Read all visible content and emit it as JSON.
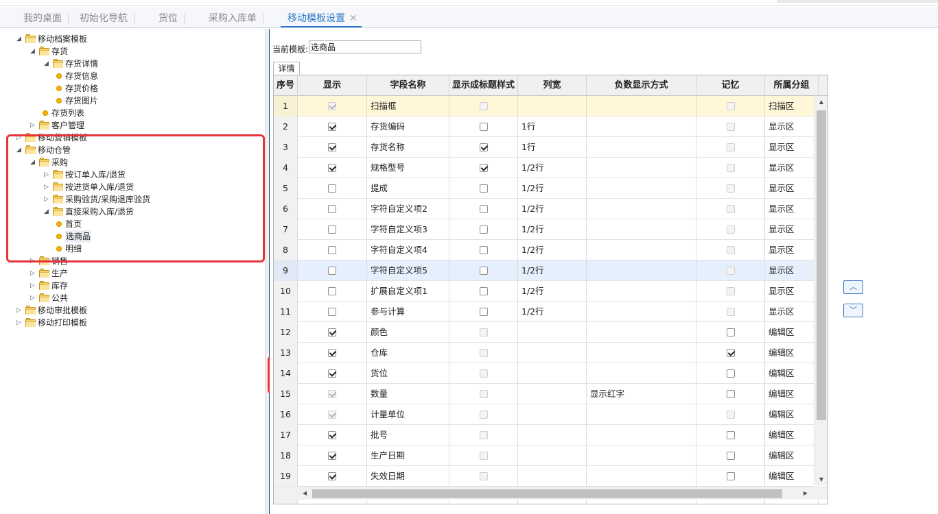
{
  "tabs": [
    {
      "label": "我的桌面"
    },
    {
      "label": "初始化导航"
    },
    {
      "label": "货位"
    },
    {
      "label": "采购入库单"
    },
    {
      "label": "移动模板设置",
      "close": "✕"
    }
  ],
  "tree": {
    "nodes": [
      {
        "label": "移动档案模板",
        "expanded": true
      },
      {
        "label": "存货",
        "expanded": true
      },
      {
        "label": "存货详情",
        "expanded": true
      },
      {
        "label": "存货信息"
      },
      {
        "label": "存货价格"
      },
      {
        "label": "存货图片"
      },
      {
        "label": "存货列表"
      },
      {
        "label": "客户管理",
        "expanded": false
      },
      {
        "label": "移动营销模板",
        "expanded": false
      },
      {
        "label": "移动仓管",
        "expanded": true
      },
      {
        "label": "采购",
        "expanded": true
      },
      {
        "label": "按订单入库/退货",
        "expanded": false
      },
      {
        "label": "按进货单入库/退货",
        "expanded": false
      },
      {
        "label": "采购验货/采购退库验货",
        "expanded": false
      },
      {
        "label": "直接采购入库/退货",
        "expanded": true
      },
      {
        "label": "首页"
      },
      {
        "label": "选商品",
        "selected": true
      },
      {
        "label": "明细"
      },
      {
        "label": "销售",
        "expanded": false
      },
      {
        "label": "生产",
        "expanded": false
      },
      {
        "label": "库存",
        "expanded": false
      },
      {
        "label": "公共",
        "expanded": false
      },
      {
        "label": "移动审批模板",
        "expanded": false
      },
      {
        "label": "移动打印模板",
        "expanded": false
      }
    ]
  },
  "main": {
    "current_template_label": "当前模板:",
    "current_template_value": "选商品",
    "detail_tab": "详情",
    "columns": [
      "序号",
      "显示",
      "字段名称",
      "显示成标题样式",
      "列宽",
      "负数显示方式",
      "记忆",
      "所属分组"
    ],
    "rows": [
      {
        "no": "1",
        "show": true,
        "show_disabled": true,
        "name": "扫描框",
        "title_style": false,
        "title_disabled": true,
        "width": "",
        "negative": "",
        "memory": false,
        "memory_disabled": true,
        "group": "扫描区",
        "highlight": "yellow"
      },
      {
        "no": "2",
        "show": true,
        "show_disabled": false,
        "name": "存货编码",
        "title_style": false,
        "title_disabled": false,
        "width": "1行",
        "negative": "",
        "memory": false,
        "memory_disabled": true,
        "group": "显示区"
      },
      {
        "no": "3",
        "show": true,
        "show_disabled": false,
        "name": "存货名称",
        "title_style": true,
        "title_disabled": false,
        "width": "1行",
        "negative": "",
        "memory": false,
        "memory_disabled": true,
        "group": "显示区"
      },
      {
        "no": "4",
        "show": true,
        "show_disabled": false,
        "name": "规格型号",
        "title_style": true,
        "title_disabled": false,
        "width": "1/2行",
        "negative": "",
        "memory": false,
        "memory_disabled": true,
        "group": "显示区"
      },
      {
        "no": "5",
        "show": false,
        "show_disabled": false,
        "name": "提成",
        "title_style": false,
        "title_disabled": false,
        "width": "1/2行",
        "negative": "",
        "memory": false,
        "memory_disabled": true,
        "group": "显示区"
      },
      {
        "no": "6",
        "show": false,
        "show_disabled": false,
        "name": "字符自定义项2",
        "title_style": false,
        "title_disabled": false,
        "width": "1/2行",
        "negative": "",
        "memory": false,
        "memory_disabled": true,
        "group": "显示区"
      },
      {
        "no": "7",
        "show": false,
        "show_disabled": false,
        "name": "字符自定义项3",
        "title_style": false,
        "title_disabled": false,
        "width": "1/2行",
        "negative": "",
        "memory": false,
        "memory_disabled": true,
        "group": "显示区"
      },
      {
        "no": "8",
        "show": false,
        "show_disabled": false,
        "name": "字符自定义项4",
        "title_style": false,
        "title_disabled": false,
        "width": "1/2行",
        "negative": "",
        "memory": false,
        "memory_disabled": true,
        "group": "显示区"
      },
      {
        "no": "9",
        "show": false,
        "show_disabled": false,
        "name": "字符自定义项5",
        "title_style": false,
        "title_disabled": false,
        "width": "1/2行",
        "negative": "",
        "memory": false,
        "memory_disabled": true,
        "group": "显示区",
        "highlight": "blue"
      },
      {
        "no": "10",
        "show": false,
        "show_disabled": false,
        "name": "扩展自定义项1",
        "title_style": false,
        "title_disabled": false,
        "width": "1/2行",
        "negative": "",
        "memory": false,
        "memory_disabled": true,
        "group": "显示区"
      },
      {
        "no": "11",
        "show": false,
        "show_disabled": false,
        "name": "参与计算",
        "title_style": false,
        "title_disabled": false,
        "width": "1/2行",
        "negative": "",
        "memory": false,
        "memory_disabled": true,
        "group": "显示区"
      },
      {
        "no": "12",
        "show": true,
        "show_disabled": false,
        "name": "颜色",
        "title_style": false,
        "title_disabled": true,
        "width": "",
        "negative": "",
        "memory": false,
        "memory_disabled": false,
        "group": "编辑区"
      },
      {
        "no": "13",
        "show": true,
        "show_disabled": false,
        "name": "仓库",
        "title_style": false,
        "title_disabled": true,
        "width": "",
        "negative": "",
        "memory": true,
        "memory_disabled": false,
        "group": "编辑区"
      },
      {
        "no": "14",
        "show": true,
        "show_disabled": false,
        "name": "货位",
        "title_style": false,
        "title_disabled": true,
        "width": "",
        "negative": "",
        "memory": false,
        "memory_disabled": false,
        "group": "编辑区"
      },
      {
        "no": "15",
        "show": true,
        "show_disabled": true,
        "name": "数量",
        "title_style": false,
        "title_disabled": true,
        "width": "",
        "negative": "显示红字",
        "memory": false,
        "memory_disabled": false,
        "group": "编辑区"
      },
      {
        "no": "16",
        "show": true,
        "show_disabled": true,
        "name": "计量单位",
        "title_style": false,
        "title_disabled": true,
        "width": "",
        "negative": "",
        "memory": false,
        "memory_disabled": true,
        "group": "编辑区"
      },
      {
        "no": "17",
        "show": true,
        "show_disabled": false,
        "name": "批号",
        "title_style": false,
        "title_disabled": true,
        "width": "",
        "negative": "",
        "memory": false,
        "memory_disabled": false,
        "group": "编辑区"
      },
      {
        "no": "18",
        "show": true,
        "show_disabled": false,
        "name": "生产日期",
        "title_style": false,
        "title_disabled": true,
        "width": "",
        "negative": "",
        "memory": false,
        "memory_disabled": false,
        "group": "编辑区"
      },
      {
        "no": "19",
        "show": true,
        "show_disabled": false,
        "name": "失效日期",
        "title_style": false,
        "title_disabled": true,
        "width": "",
        "negative": "",
        "memory": false,
        "memory_disabled": false,
        "group": "编辑区"
      },
      {
        "no": "",
        "show": false,
        "show_disabled": true,
        "name": "",
        "title_style": false,
        "title_disabled": true,
        "width": "",
        "negative": "",
        "memory": false,
        "memory_disabled": true,
        "group": "",
        "blank": true
      }
    ],
    "move_up": "︿",
    "move_down": "﹀"
  },
  "colors": {
    "accent": "#2b79c9",
    "annotation_red": "#e8333a",
    "row_selected": "#fff7d7",
    "row_hover": "#e6f0fc"
  },
  "icons": {
    "folder": "folder-icon",
    "leaf": "leaf-dot-icon",
    "expand": "triangle-collapse-icon",
    "collapse": "triangle-expand-icon"
  }
}
